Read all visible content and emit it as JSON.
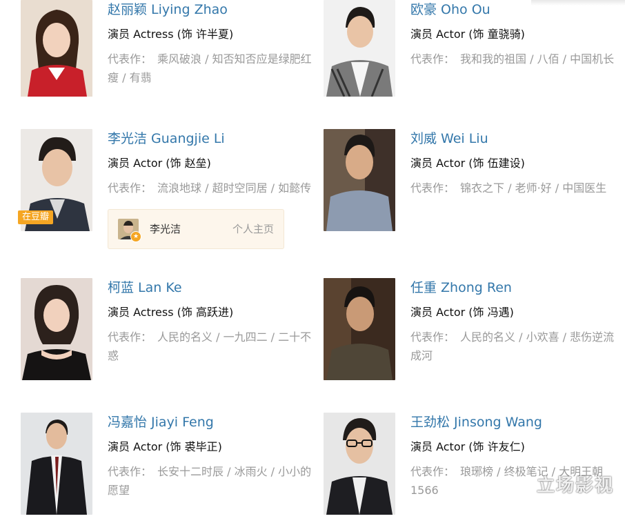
{
  "cast": [
    {
      "name": "赵丽颖 Liying Zhao",
      "role": "演员 Actress (饰 许半夏)",
      "works_label": "代表作：",
      "works": "乘风破浪 / 知否知否应是绿肥红瘦 / 有翡"
    },
    {
      "name": "欧豪 Oho Ou",
      "role": "演员 Actor (饰 童骁骑)",
      "works_label": "代表作：",
      "works": "我和我的祖国 / 八佰 / 中国机长"
    },
    {
      "name": "李光洁 Guangjie Li",
      "role": "演员 Actor (饰 赵垒)",
      "works_label": "代表作：",
      "works": "流浪地球 / 超时空同居 / 如懿传",
      "badge": "在豆瓣",
      "profile": {
        "name": "李光洁",
        "link": "个人主页"
      }
    },
    {
      "name": "刘威 Wei Liu",
      "role": "演员 Actor (饰 伍建设)",
      "works_label": "代表作：",
      "works": "锦衣之下 / 老师·好 / 中国医生"
    },
    {
      "name": "柯蓝 Lan Ke",
      "role": "演员 Actress (饰 高跃进)",
      "works_label": "代表作：",
      "works": "人民的名义 / 一九四二 / 二十不惑"
    },
    {
      "name": "任重 Zhong Ren",
      "role": "演员 Actor (饰 冯遇)",
      "works_label": "代表作：",
      "works": "人民的名义 / 小欢喜 / 悲伤逆流成河"
    },
    {
      "name": "冯嘉怡 Jiayi Feng",
      "role": "演员 Actor (饰 裘毕正)",
      "works_label": "代表作：",
      "works": "长安十二时辰 / 冰雨火 / 小小的愿望"
    },
    {
      "name": "王劲松 Jinsong Wang",
      "role": "演员 Actor (饰 许友仁)",
      "works_label": "代表作：",
      "works": "琅琊榜 / 终极笔记 / 大明王朝1566"
    }
  ],
  "watermark": "立场影视",
  "colors": {
    "name_link": "#3377aa",
    "badge": "#f5a623",
    "profile_bg": "#fdf6ec",
    "muted": "#999999"
  }
}
